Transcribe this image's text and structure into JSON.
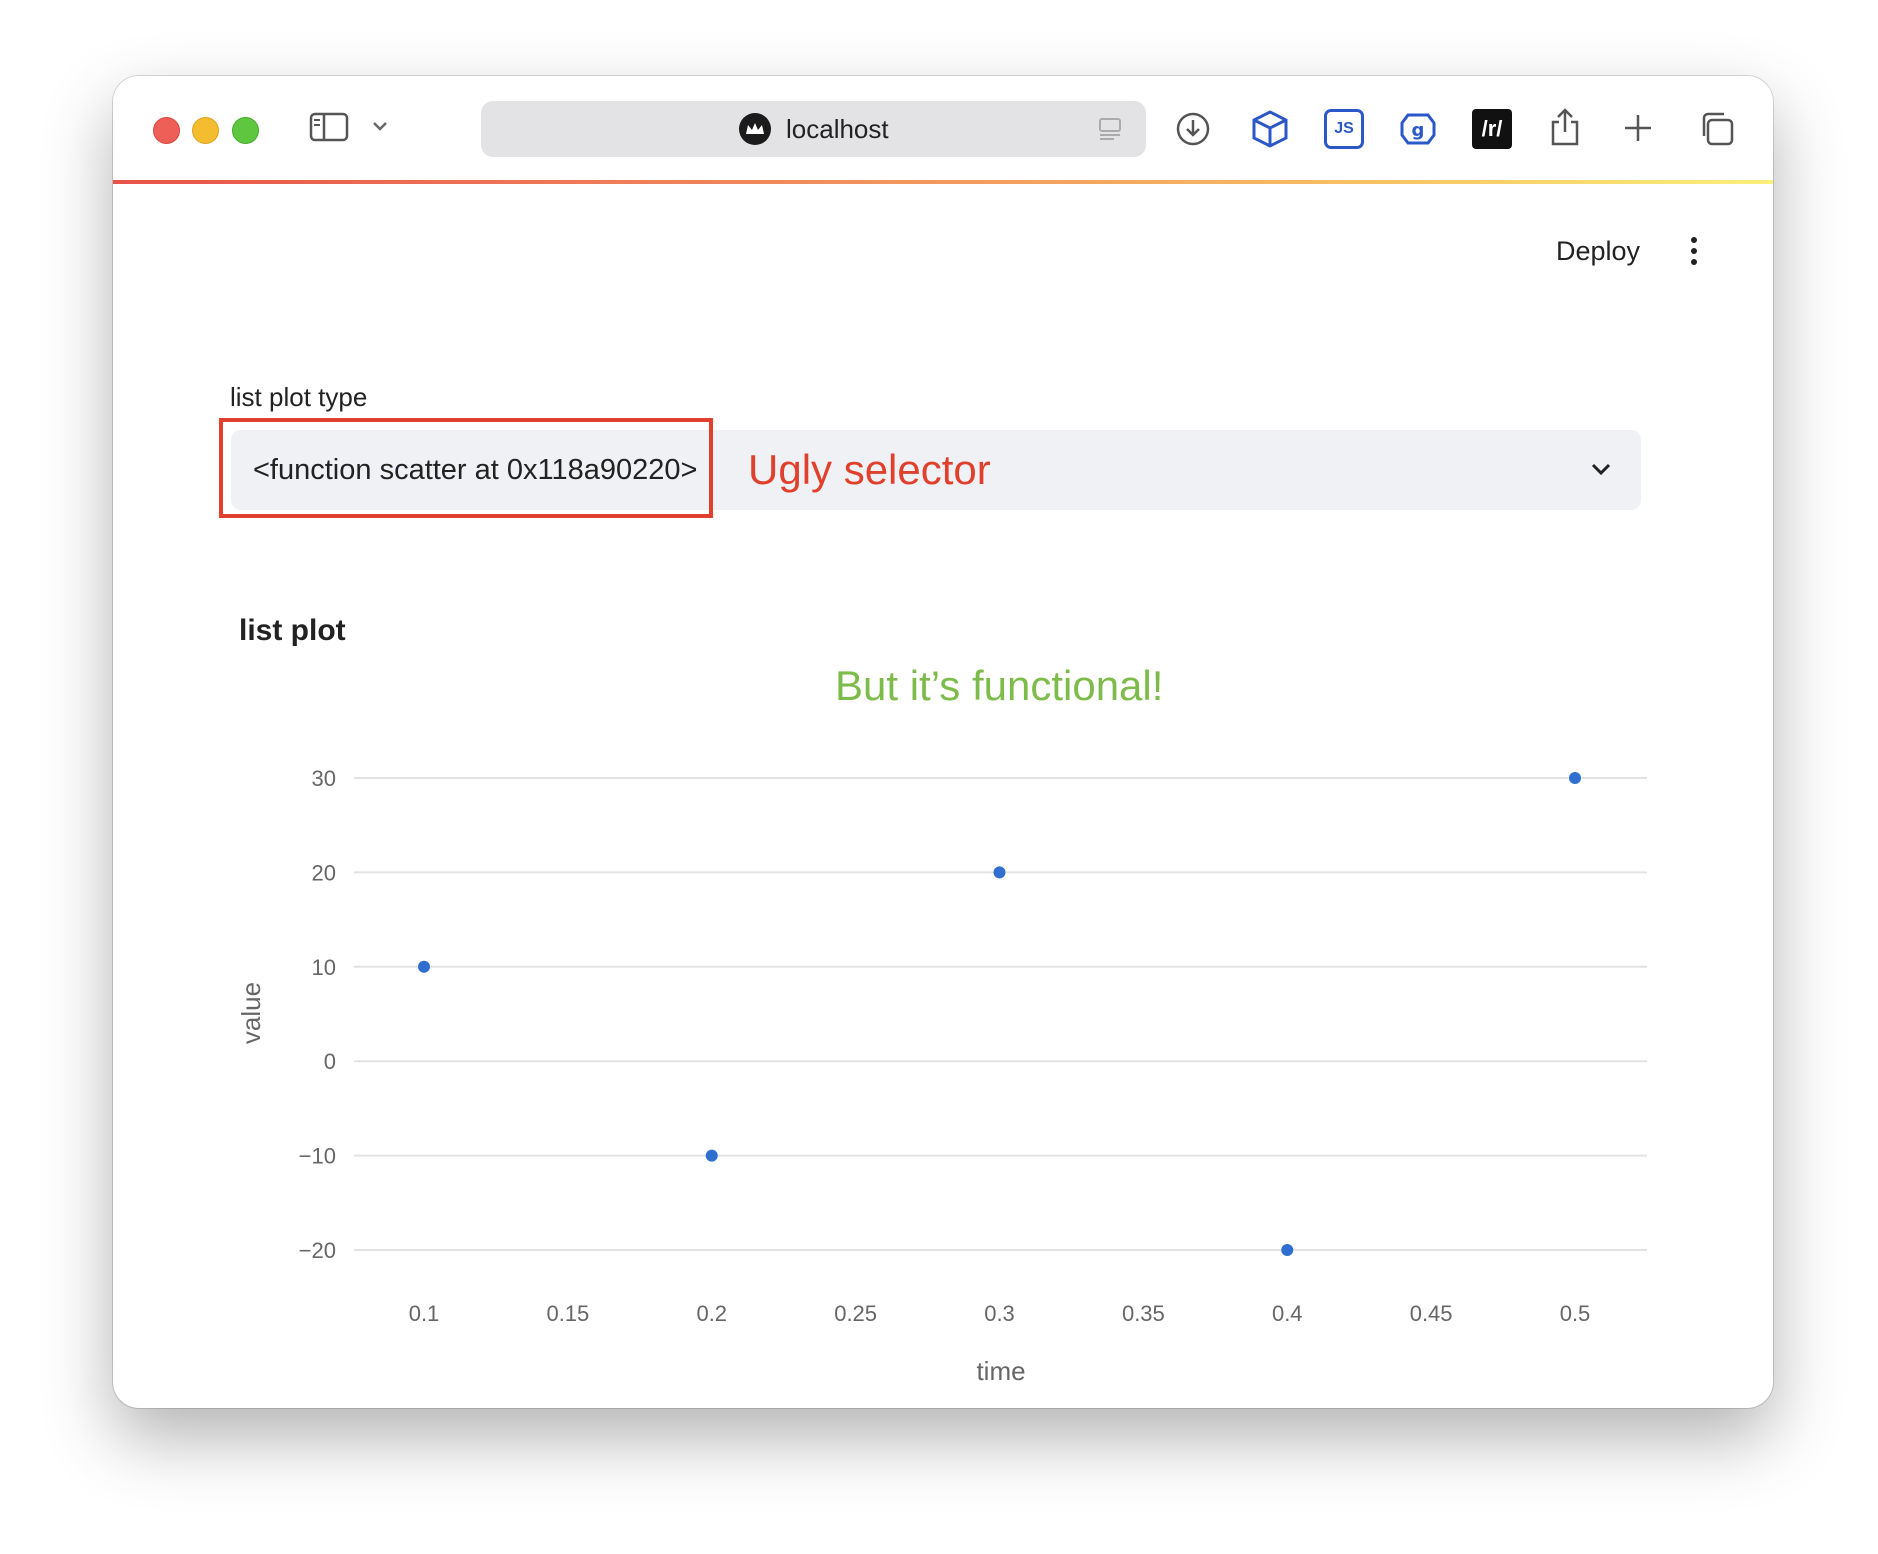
{
  "browser": {
    "url": "localhost",
    "toolbar_icons": [
      "download-icon",
      "package-icon",
      "js-extension-icon",
      "settings-extension-icon",
      "reddit-extension-icon",
      "share-icon",
      "new-tab-icon",
      "tabs-overview-icon"
    ],
    "reddit_ext_label": "/r/",
    "js_ext_label": "JS"
  },
  "app": {
    "deploy_label": "Deploy",
    "select": {
      "label": "list plot type",
      "value": "<function scatter at 0x118a90220>"
    },
    "annotations": {
      "selector_note": "Ugly selector",
      "chart_note": "But it’s functional!"
    },
    "chart_title": "list plot"
  },
  "colors": {
    "annotation_red": "#e0402c",
    "annotation_green": "#7dbb4a",
    "point_color": "#2f6fd0"
  },
  "chart_data": {
    "type": "scatter",
    "x": [
      0.1,
      0.2,
      0.3,
      0.4,
      0.5
    ],
    "y": [
      10,
      -10,
      20,
      -20,
      30
    ],
    "xlabel": "time",
    "ylabel": "value",
    "xlim": [
      0.1,
      0.5
    ],
    "ylim": [
      -20,
      30
    ],
    "xticks": [
      0.1,
      0.15,
      0.2,
      0.25,
      0.3,
      0.35,
      0.4,
      0.45,
      0.5
    ],
    "xtick_labels": [
      "0.1",
      "0.15",
      "0.2",
      "0.25",
      "0.3",
      "0.35",
      "0.4",
      "0.45",
      "0.5"
    ],
    "yticks": [
      30,
      20,
      10,
      0,
      -10,
      -20
    ],
    "ytick_labels": [
      "30",
      "20",
      "10",
      "0",
      "−10",
      "−20"
    ],
    "grid": true
  }
}
